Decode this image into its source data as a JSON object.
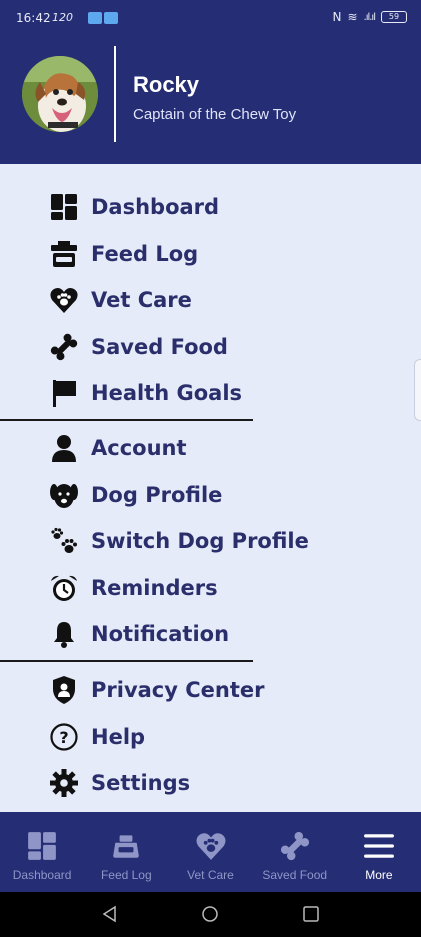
{
  "status_bar": {
    "time": "16:42",
    "net_speed": "120",
    "battery": "59"
  },
  "profile": {
    "name": "Rocky",
    "tagline": "Captain of the Chew Toy"
  },
  "menu": {
    "sections": [
      [
        {
          "label": "Dashboard",
          "icon": "dashboard-icon"
        },
        {
          "label": "Feed Log",
          "icon": "feed-bowl-icon"
        },
        {
          "label": "Vet Care",
          "icon": "heart-paw-icon"
        },
        {
          "label": "Saved Food",
          "icon": "bone-icon"
        },
        {
          "label": "Health Goals",
          "icon": "flag-icon"
        }
      ],
      [
        {
          "label": "Account",
          "icon": "person-icon"
        },
        {
          "label": "Dog Profile",
          "icon": "dog-face-icon"
        },
        {
          "label": "Switch Dog Profile",
          "icon": "paws-icon"
        },
        {
          "label": "Reminders",
          "icon": "alarm-clock-icon"
        },
        {
          "label": "Notification",
          "icon": "bell-icon"
        }
      ],
      [
        {
          "label": "Privacy Center",
          "icon": "shield-user-icon"
        },
        {
          "label": "Help",
          "icon": "question-circle-icon"
        },
        {
          "label": "Settings",
          "icon": "gear-icon"
        }
      ]
    ]
  },
  "bottom_nav": {
    "items": [
      {
        "label": "Dashboard",
        "icon": "dashboard-icon",
        "active": false
      },
      {
        "label": "Feed Log",
        "icon": "feed-bowl-icon",
        "active": false
      },
      {
        "label": "Vet Care",
        "icon": "heart-paw-icon",
        "active": false
      },
      {
        "label": "Saved Food",
        "icon": "bone-icon",
        "active": false
      },
      {
        "label": "More",
        "icon": "menu-icon",
        "active": true
      }
    ]
  },
  "colors": {
    "header_bg": "#252d74",
    "menu_bg": "#e6ebf9",
    "menu_text": "#2a2f6b",
    "nav_inactive": "#8f96c7",
    "nav_active": "#ffffff"
  }
}
